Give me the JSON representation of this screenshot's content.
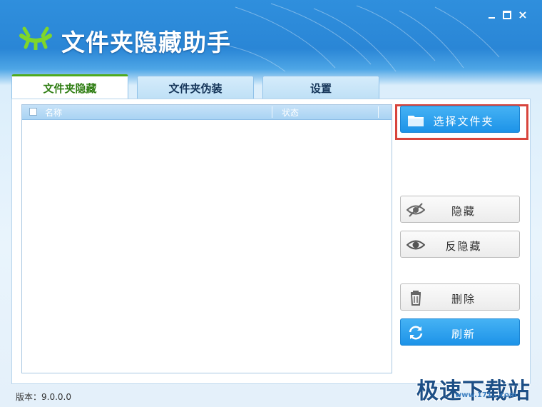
{
  "app": {
    "title": "文件夹隐藏助手",
    "window_controls": {
      "minimize": "minimize",
      "maximize": "maximize",
      "close": "×"
    }
  },
  "tabs": [
    {
      "label": "文件夹隐藏",
      "active": true
    },
    {
      "label": "文件夹伪装",
      "active": false
    },
    {
      "label": "设置",
      "active": false
    }
  ],
  "list": {
    "columns": [
      "名称",
      "状态"
    ],
    "rows": []
  },
  "actions": {
    "select_folder": {
      "label": "选择文件夹",
      "icon": "folder-icon"
    },
    "hide": {
      "label": "隐藏",
      "icon": "eye-slash-icon"
    },
    "unhide": {
      "label": "反隐藏",
      "icon": "eye-icon"
    },
    "delete": {
      "label": "删除",
      "icon": "trash-icon"
    },
    "refresh": {
      "label": "刷新",
      "icon": "refresh-icon"
    }
  },
  "status": {
    "version": "版本：9.0.0.0"
  },
  "watermark": {
    "text": "极速下载站",
    "url": "www.171...com"
  },
  "colors": {
    "accent_blue": "#1d93e8",
    "tab_active_green": "#4faa1e",
    "highlight_red": "#d8443c"
  }
}
